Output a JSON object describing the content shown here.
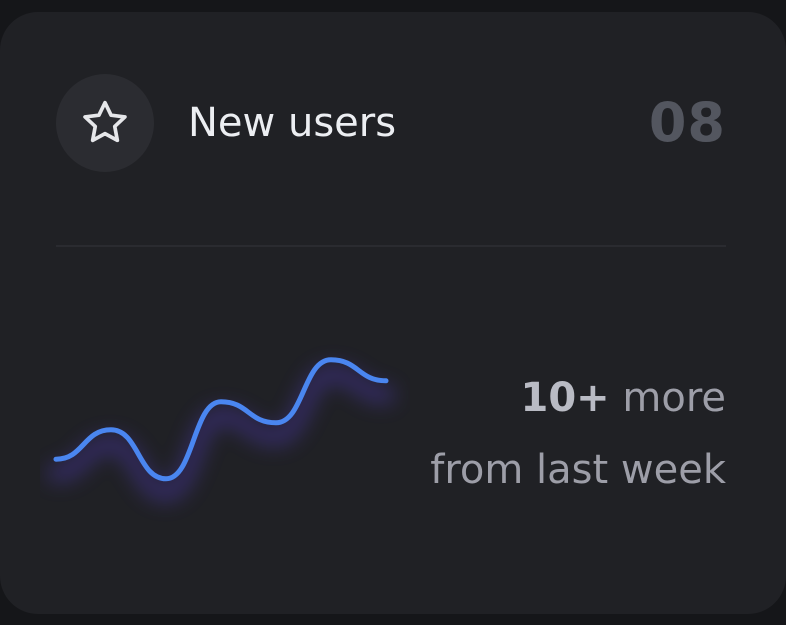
{
  "card": {
    "icon": "star-icon",
    "title": "New users",
    "count": "08",
    "summary": {
      "highlight": "10+",
      "line1_rest": " more",
      "line2": "from last week"
    }
  },
  "sparkline": {
    "color": "#4a86f0",
    "shadow_color": "#5a3fd9",
    "values": [
      0.22,
      0.43,
      0.08,
      0.63,
      0.48,
      0.93,
      0.78
    ]
  },
  "colors": {
    "page_background": "#151619",
    "card_background": "#202125",
    "icon_background": "#2b2c31",
    "title": "#eceef2",
    "count": "#53565f",
    "summary": "#9d9ea8"
  }
}
